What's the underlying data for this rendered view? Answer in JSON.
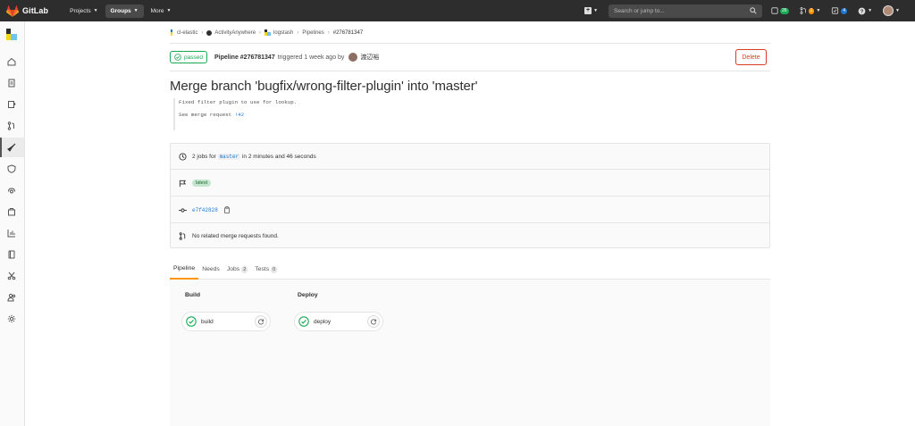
{
  "topnav": {
    "logo": "GitLab",
    "items": [
      {
        "label": "Projects"
      },
      {
        "label": "Groups"
      },
      {
        "label": "More"
      }
    ],
    "search_placeholder": "Search or jump to...",
    "mr_count": "26",
    "issue_count": "1",
    "todo_count": "4"
  },
  "breadcrumb": {
    "items": [
      "cl-elastic",
      "ActivityAnywhere",
      "logstash",
      "Pipelines",
      "#276781347"
    ]
  },
  "pipeline": {
    "status": "passed",
    "id_label": "Pipeline #276781347",
    "triggered_text": "triggered 1 week ago by",
    "user": "渡辺裕",
    "delete_label": "Delete",
    "title": "Merge branch 'bugfix/wrong-filter-plugin' into 'master'",
    "description_line1": "Fixed filter plugin to use for lookup.",
    "description_line2_prefix": "See merge request",
    "description_mr": "!42"
  },
  "info": {
    "jobs_prefix": "2 jobs for",
    "branch": "master",
    "jobs_suffix": "in 2 minutes and 46 seconds",
    "badge": "latest",
    "sha": "e7f42828",
    "no_mr": "No related merge requests found."
  },
  "tabs": [
    {
      "label": "Pipeline",
      "count": null
    },
    {
      "label": "Needs",
      "count": null
    },
    {
      "label": "Jobs",
      "count": "2"
    },
    {
      "label": "Tests",
      "count": "0"
    }
  ],
  "stages": [
    {
      "name": "Build",
      "job": "build"
    },
    {
      "name": "Deploy",
      "job": "deploy"
    }
  ],
  "colors": {
    "success": "#1aaa55",
    "danger": "#db3b21",
    "link": "#1f78d1",
    "navbar": "#2d2d2d",
    "active_tab": "#fc9403"
  }
}
